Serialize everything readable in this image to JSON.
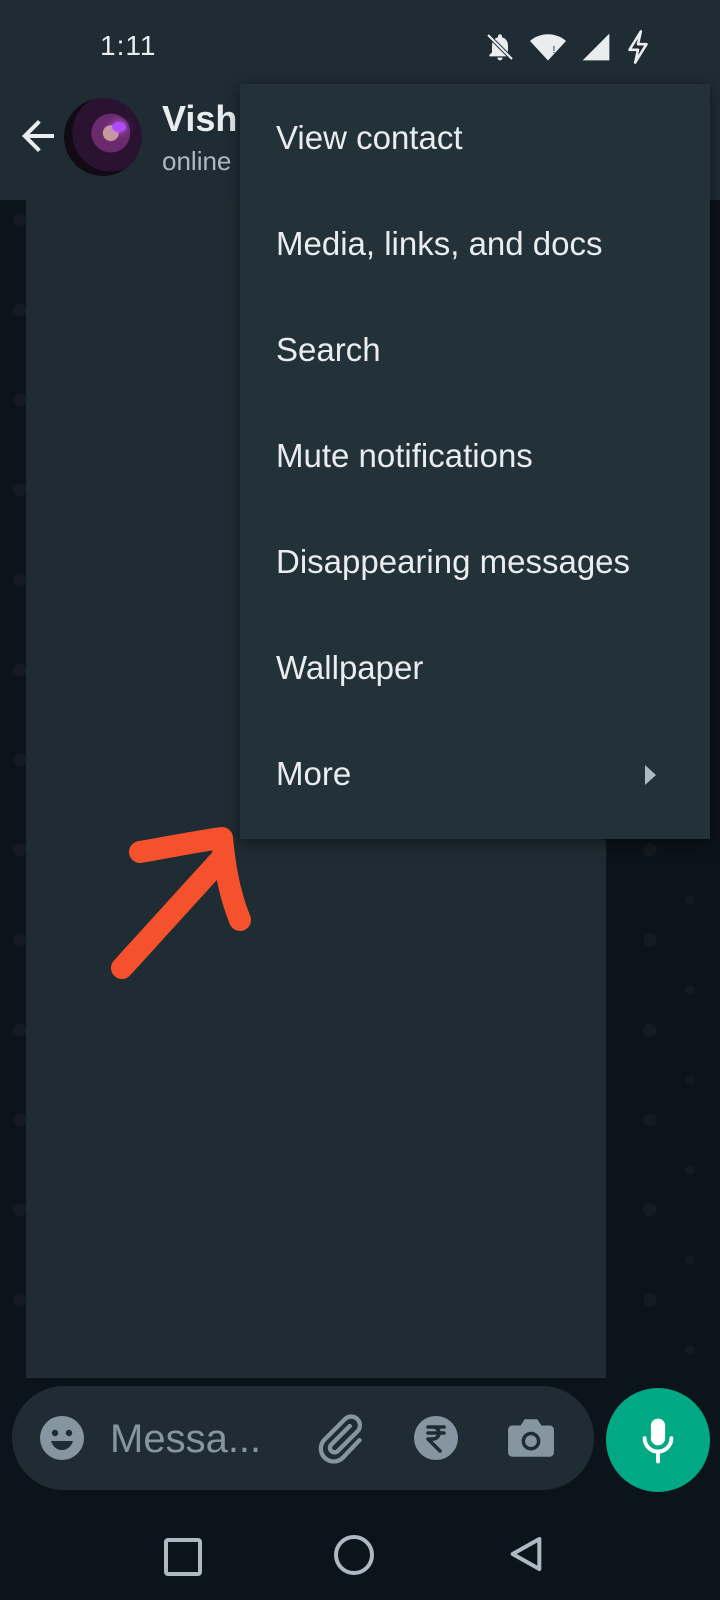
{
  "status_bar": {
    "time": "1:11",
    "icons": [
      "bell-off-icon",
      "wifi-icon",
      "signal-icon",
      "charging-icon"
    ]
  },
  "header": {
    "contact_name": "Vish",
    "contact_status": "online"
  },
  "menu": {
    "items": [
      {
        "label": "View contact"
      },
      {
        "label": "Media, links, and docs"
      },
      {
        "label": "Search"
      },
      {
        "label": "Mute notifications"
      },
      {
        "label": "Disappearing messages"
      },
      {
        "label": "Wallpaper"
      },
      {
        "label": "More",
        "has_submenu": true
      }
    ]
  },
  "input_bar": {
    "placeholder": "Messa..."
  },
  "colors": {
    "accent": "#00a884",
    "surface": "#1f2c34",
    "menu": "#233138",
    "annotation": "#f4512c"
  }
}
